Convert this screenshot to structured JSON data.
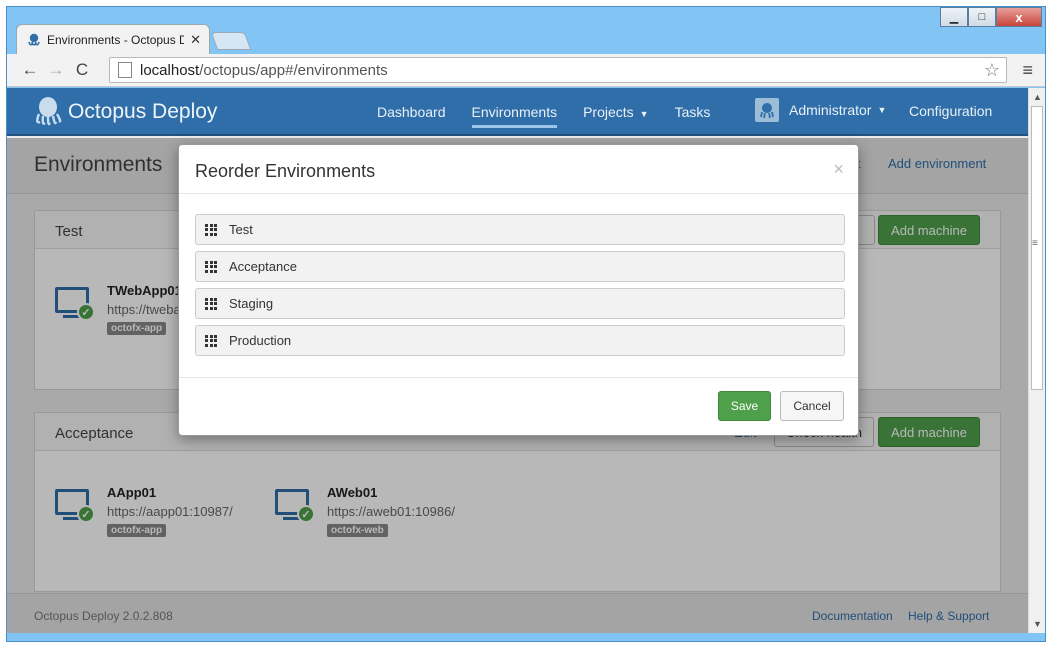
{
  "browser": {
    "tab_title": "Environments - Octopus D",
    "url_host": "localhost",
    "url_path": "/octopus/app#/environments",
    "win_min": "▁",
    "win_max": "□",
    "win_close": "x"
  },
  "app": {
    "brand": "Octopus Deploy",
    "nav": [
      "Dashboard",
      "Environments",
      "Projects",
      "Tasks"
    ],
    "user": "Administrator",
    "config": "Configuration",
    "page_title": "Environments",
    "header_actions": {
      "reorder_fragment": "t",
      "add_environment": "Add environment"
    }
  },
  "environments": [
    {
      "name": "Test",
      "add_machine": "Add machine",
      "machines": [
        {
          "name": "TWebApp01",
          "url": "https://tweba",
          "tag": "octofx-app"
        }
      ]
    },
    {
      "name": "Acceptance",
      "edit": "Edit",
      "check_health": "Check health",
      "add_machine": "Add machine",
      "machines": [
        {
          "name": "AApp01",
          "url": "https://aapp01:10987/",
          "tag": "octofx-app"
        },
        {
          "name": "AWeb01",
          "url": "https://aweb01:10986/",
          "tag": "octofx-web"
        }
      ]
    }
  ],
  "footer": {
    "version": "Octopus Deploy 2.0.2.808",
    "documentation": "Documentation",
    "help": "Help & Support"
  },
  "modal": {
    "title": "Reorder Environments",
    "close": "×",
    "items": [
      "Test",
      "Acceptance",
      "Staging",
      "Production"
    ],
    "save": "Save",
    "cancel": "Cancel"
  },
  "colors": {
    "accent": "#2f6ea8",
    "success": "#4fa04a"
  }
}
